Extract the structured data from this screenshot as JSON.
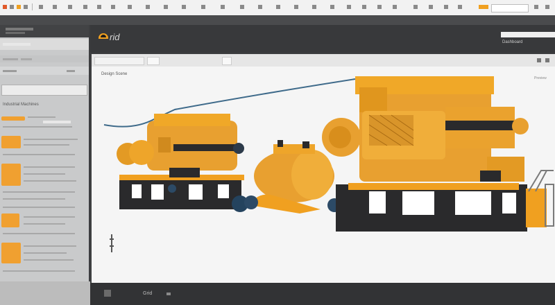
{
  "app": {
    "logo_text": "rid",
    "header_user": "Dashboard"
  },
  "sidebar": {
    "section_title": "Industrial Machines"
  },
  "viewport": {
    "title": "Design Scene",
    "note": "Preview"
  },
  "status": {
    "text": "Grid"
  },
  "colors": {
    "accent": "#f0a020",
    "machine_body": "#e8a030",
    "machine_base": "#2a2a2c",
    "motor": "#2c4a66",
    "cable": "#3e6a8a"
  },
  "icons": [
    "app-logo-icon",
    "toolbar-icon",
    "layers-icon",
    "settings-icon",
    "ruler-icon"
  ]
}
